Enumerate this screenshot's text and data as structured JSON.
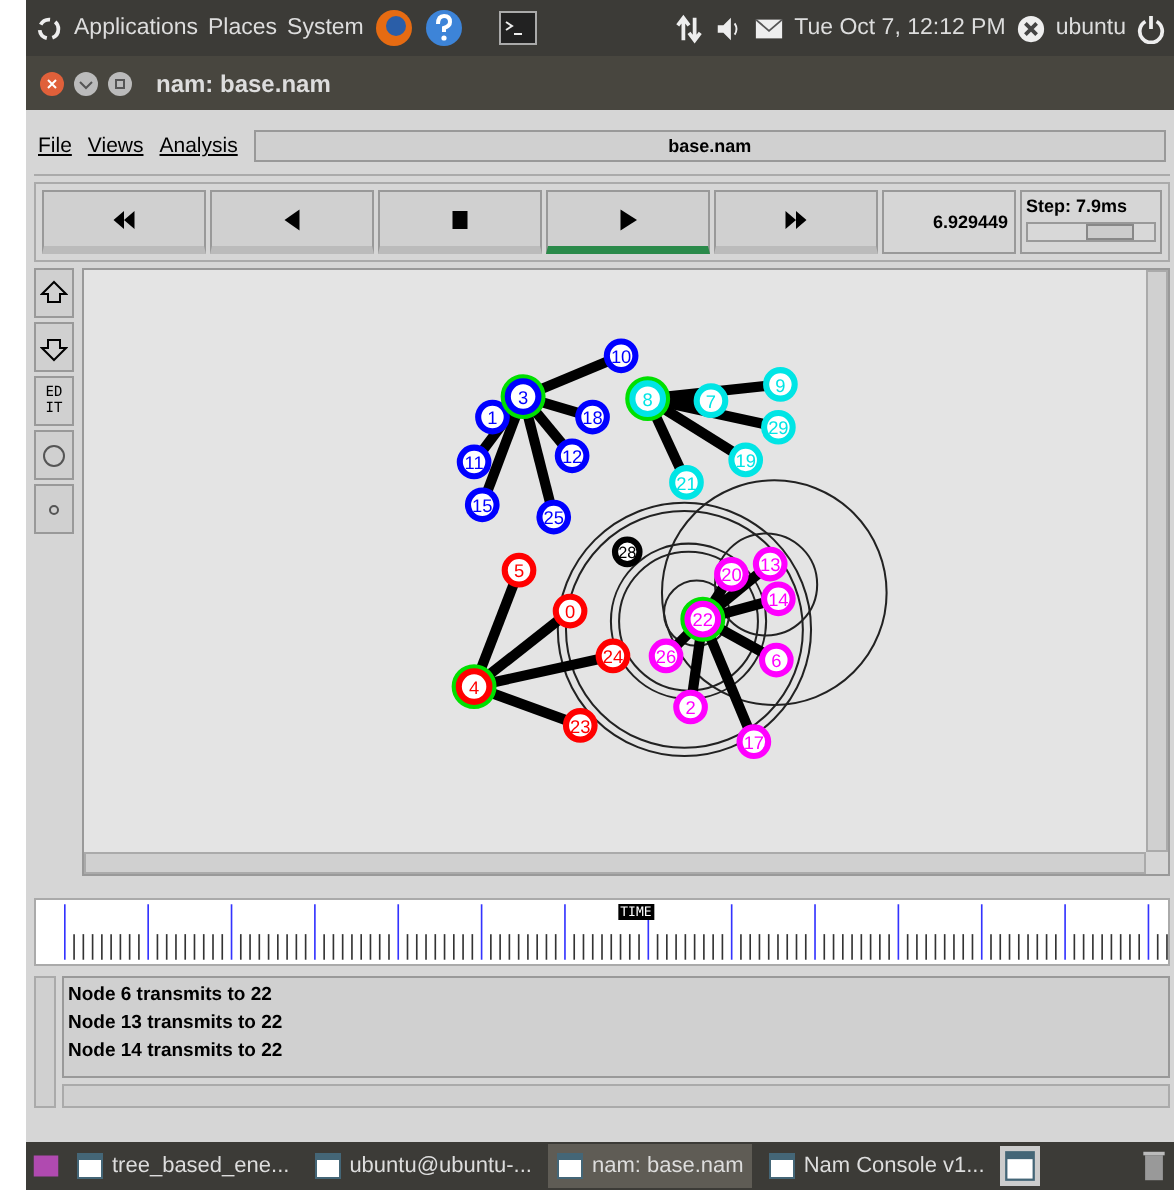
{
  "top_panel": {
    "menus": [
      "Applications",
      "Places",
      "System"
    ],
    "clock": "Tue Oct  7, 12:12 PM",
    "user": "ubuntu"
  },
  "window": {
    "title": "nam: base.nam"
  },
  "menu": [
    "File",
    "Views",
    "Analysis"
  ],
  "file_label": "base.nam",
  "playback": [
    {
      "kind": "rewind",
      "selected": false
    },
    {
      "kind": "back",
      "selected": false
    },
    {
      "kind": "stop",
      "selected": false
    },
    {
      "kind": "play",
      "selected": true
    },
    {
      "kind": "forward",
      "selected": false
    }
  ],
  "time": "6.929449",
  "step": {
    "label": "Step: 7.9ms",
    "level": 0.65
  },
  "tools": [
    {
      "kind": "zoom-in"
    },
    {
      "kind": "zoom-out"
    },
    {
      "kind": "edit",
      "label": "EDIT"
    },
    {
      "kind": "circle"
    },
    {
      "kind": "dot"
    }
  ],
  "clusters": [
    {
      "color": "#0000ff",
      "center": "3",
      "members": [
        "10",
        "18",
        "12",
        "1",
        "11",
        "15",
        "25"
      ]
    },
    {
      "color": "#00e5e5",
      "center": "8",
      "members": [
        "7",
        "9",
        "29",
        "19",
        "21"
      ]
    },
    {
      "color": "#ff0000",
      "center": "4",
      "members": [
        "5",
        "0",
        "24",
        "23"
      ]
    },
    {
      "color": "#ff00ff",
      "center": "22",
      "members": [
        "20",
        "13",
        "14",
        "6",
        "26",
        "2",
        "17"
      ]
    }
  ],
  "lone_node": {
    "label": "28",
    "color": "#000000"
  },
  "timeline": {
    "marker": "TIME",
    "level": 0.53
  },
  "log": [
    "Node 6 transmits to 22",
    "Node 13 transmits to 22",
    "Node 14 transmits to 22"
  ],
  "taskbar": [
    {
      "label": "tree_based_ene...",
      "selected": false
    },
    {
      "label": "ubuntu@ubuntu-...",
      "selected": false
    },
    {
      "label": "nam: base.nam",
      "selected": true
    },
    {
      "label": "Nam Console v1...",
      "selected": false
    }
  ]
}
